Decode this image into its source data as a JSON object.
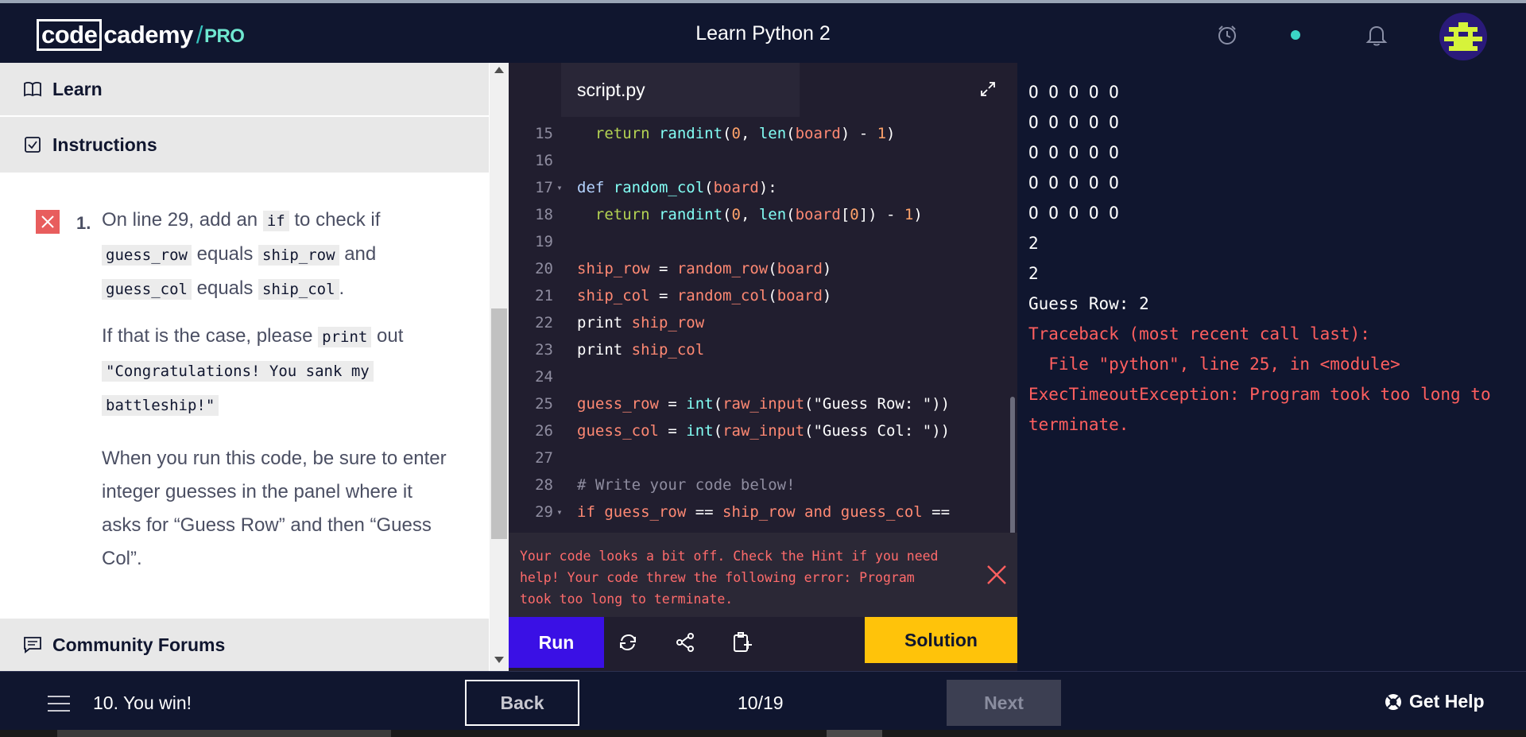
{
  "header": {
    "logo_box": "code",
    "logo_rest": "cademy",
    "logo_slash": "/",
    "logo_pro": "PRO",
    "course_title": "Learn Python 2",
    "icons": [
      "alarm-icon",
      "status-dot",
      "bell-icon",
      "avatar"
    ],
    "accent": "#3bd5c6"
  },
  "left_panel": {
    "learn_label": "Learn",
    "instructions_label": "Instructions",
    "community_label": "Community Forums",
    "step_number": "1.",
    "step": {
      "p1_a": "On line 29, add an ",
      "p1_code1": "if",
      "p1_b": " to check if",
      "p1_code2": "guess_row",
      "p1_c": " equals ",
      "p1_code3": "ship_row",
      "p1_d": " and",
      "p1_code4": "guess_col",
      "p1_e": " equals ",
      "p1_code5": "ship_col",
      "p1_f": ".",
      "p2_a": "If that is the case, please ",
      "p2_code1": "print",
      "p2_b": " out",
      "p2_code2a": "\"Congratulations! You sank my",
      "p2_code2b": "battleship!\"",
      "p3": "When you run this code, be sure to enter integer guesses in the panel where it asks for “Guess Row” and then “Guess Col”."
    },
    "fail_color": "#e85d5d"
  },
  "editor": {
    "tab_name": "script.py",
    "lines": [
      {
        "n": "15",
        "fold": ""
      },
      {
        "n": "16",
        "fold": ""
      },
      {
        "n": "17",
        "fold": "▾"
      },
      {
        "n": "18",
        "fold": ""
      },
      {
        "n": "19",
        "fold": ""
      },
      {
        "n": "20",
        "fold": ""
      },
      {
        "n": "21",
        "fold": ""
      },
      {
        "n": "22",
        "fold": ""
      },
      {
        "n": "23",
        "fold": ""
      },
      {
        "n": "24",
        "fold": ""
      },
      {
        "n": "25",
        "fold": ""
      },
      {
        "n": "26",
        "fold": ""
      },
      {
        "n": "27",
        "fold": ""
      },
      {
        "n": "28",
        "fold": ""
      },
      {
        "n": "29",
        "fold": "▾"
      }
    ],
    "code": {
      "l15": [
        "  return ",
        "randint",
        "(",
        "0",
        ", ",
        "len",
        "(",
        "board",
        ") - ",
        "1",
        ")"
      ],
      "l17": [
        "def ",
        "random_col",
        "(",
        "board",
        "):"
      ],
      "l18": [
        "  return ",
        "randint",
        "(",
        "0",
        ", ",
        "len",
        "(",
        "board",
        "[",
        "0",
        "]) - ",
        "1",
        ")"
      ],
      "l20": [
        "ship_row",
        " = ",
        "random_row",
        "(",
        "board",
        ")"
      ],
      "l21": [
        "ship_col",
        " = ",
        "random_col",
        "(",
        "board",
        ")"
      ],
      "l22": [
        "print ",
        "ship_row"
      ],
      "l23": [
        "print ",
        "ship_col"
      ],
      "l25": [
        "guess_row",
        " = ",
        "int",
        "(",
        "raw_input",
        "(",
        "\"Guess Row: \"",
        "))"
      ],
      "l26": [
        "guess_col",
        " = ",
        "int",
        "(",
        "raw_input",
        "(",
        "\"Guess Col: \"",
        "))"
      ],
      "l28": [
        "# Write your code below!"
      ],
      "l29": [
        "if ",
        "guess_row",
        " == ",
        "ship_row",
        " and ",
        "guess_col",
        " =="
      ]
    },
    "error_message": "Your code looks a bit off. Check the Hint if you need help! Your code threw the following error: Program took too long to terminate.",
    "run_label": "Run",
    "solution_label": "Solution",
    "run_color": "#3a10e5",
    "solution_color": "#ffc30a"
  },
  "output": {
    "lines": [
      {
        "text": "O O O O O",
        "type": "normal"
      },
      {
        "text": "O O O O O",
        "type": "normal"
      },
      {
        "text": "O O O O O",
        "type": "normal"
      },
      {
        "text": "O O O O O",
        "type": "normal"
      },
      {
        "text": "O O O O O",
        "type": "normal"
      },
      {
        "text": "2",
        "type": "normal"
      },
      {
        "text": "2",
        "type": "normal"
      },
      {
        "text": "Guess Row: 2",
        "type": "normal"
      },
      {
        "text": "Traceback (most recent call last):",
        "type": "err"
      },
      {
        "text": "  File \"python\", line 25, in <module>",
        "type": "err"
      },
      {
        "text": "ExecTimeoutException: Program took too long to",
        "type": "err"
      },
      {
        "text": "terminate.",
        "type": "err"
      }
    ],
    "error_color": "#ff5f5f"
  },
  "footer": {
    "lesson_name": "10. You win!",
    "back_label": "Back",
    "progress": "10/19",
    "next_label": "Next",
    "help_label": "Get Help"
  }
}
